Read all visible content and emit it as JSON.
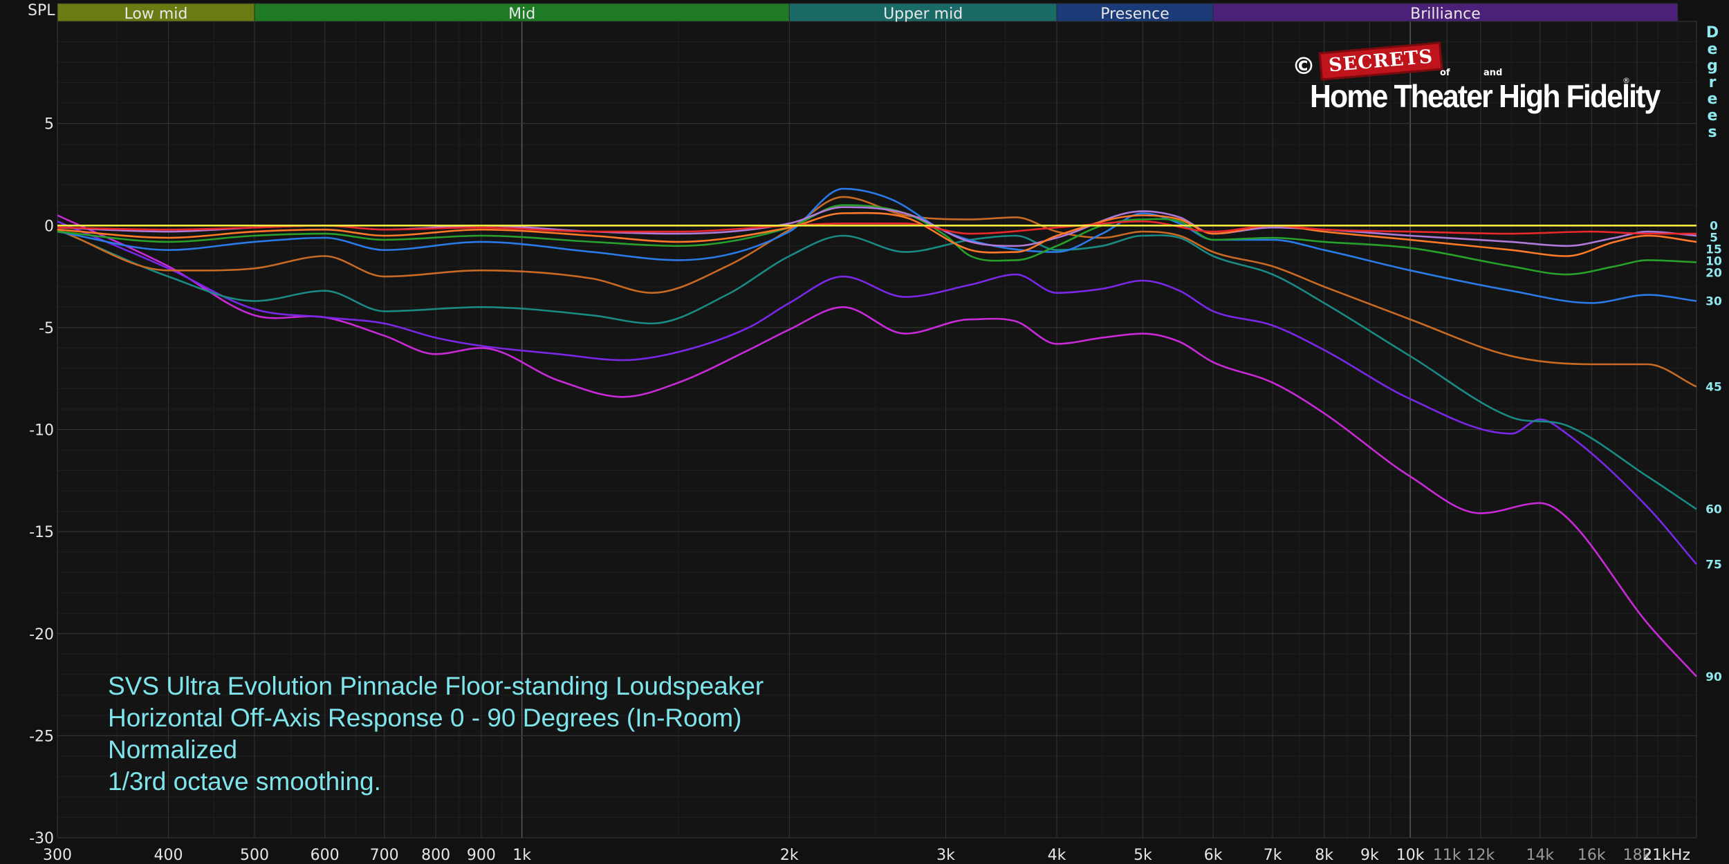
{
  "chart_data": {
    "type": "line",
    "ylabel": "SPL",
    "xunit_label": "21kHz",
    "secondary_axis_title": "Degrees",
    "ylim": [
      -30,
      10
    ],
    "xlim": [
      300,
      21000
    ],
    "x_scale": "log",
    "grid": true,
    "y_ticks": [
      5,
      0,
      -5,
      -10,
      -15,
      -20,
      -25,
      -30
    ],
    "x_ticks": [
      {
        "value": 300,
        "label": "300"
      },
      {
        "value": 400,
        "label": "400"
      },
      {
        "value": 500,
        "label": "500"
      },
      {
        "value": 600,
        "label": "600"
      },
      {
        "value": 700,
        "label": "700"
      },
      {
        "value": 800,
        "label": "800"
      },
      {
        "value": 900,
        "label": "900"
      },
      {
        "value": 1000,
        "label": "1k"
      },
      {
        "value": 2000,
        "label": "2k"
      },
      {
        "value": 3000,
        "label": "3k"
      },
      {
        "value": 4000,
        "label": "4k"
      },
      {
        "value": 5000,
        "label": "5k"
      },
      {
        "value": 6000,
        "label": "6k"
      },
      {
        "value": 7000,
        "label": "7k"
      },
      {
        "value": 8000,
        "label": "8k"
      },
      {
        "value": 9000,
        "label": "9k"
      },
      {
        "value": 10000,
        "label": "10k"
      },
      {
        "value": 11000,
        "label": "11k",
        "dim": true
      },
      {
        "value": 12000,
        "label": "12k",
        "dim": true
      },
      {
        "value": 14000,
        "label": "14k",
        "dim": true
      },
      {
        "value": 16000,
        "label": "16k",
        "dim": true
      },
      {
        "value": 18000,
        "label": "18k",
        "dim": true
      }
    ],
    "bands": [
      {
        "label": "Low mid",
        "from": 300,
        "to": 500,
        "color": "#6b7a12"
      },
      {
        "label": "Mid",
        "from": 500,
        "to": 2000,
        "color": "#1e7a24"
      },
      {
        "label": "Upper mid",
        "from": 2000,
        "to": 4000,
        "color": "#1a6b68"
      },
      {
        "label": "Presence",
        "from": 4000,
        "to": 6000,
        "color": "#1a3a78"
      },
      {
        "label": "Brilliance",
        "from": 6000,
        "to": 20000,
        "color": "#4a2078"
      }
    ],
    "series": [
      {
        "name": "0",
        "color": "#f2ea3c",
        "points": [
          [
            300,
            0
          ],
          [
            21000,
            0
          ]
        ]
      },
      {
        "name": "5",
        "color": "#e8282a",
        "points": [
          [
            300,
            -0.1
          ],
          [
            400,
            -0.2
          ],
          [
            500,
            -0.1
          ],
          [
            600,
            0
          ],
          [
            700,
            -0.2
          ],
          [
            900,
            -0.1
          ],
          [
            1200,
            -0.3
          ],
          [
            1500,
            -0.3
          ],
          [
            2000,
            0
          ],
          [
            2300,
            0.1
          ],
          [
            2700,
            0.1
          ],
          [
            3200,
            -0.4
          ],
          [
            4000,
            -0.1
          ],
          [
            5000,
            0.2
          ],
          [
            6000,
            -0.3
          ],
          [
            7000,
            0
          ],
          [
            8000,
            -0.2
          ],
          [
            10000,
            -0.3
          ],
          [
            13000,
            -0.4
          ],
          [
            16000,
            -0.3
          ],
          [
            18500,
            -0.4
          ],
          [
            21000,
            -0.4
          ]
        ]
      },
      {
        "name": "10",
        "color": "#ff7a28",
        "points": [
          [
            300,
            -0.2
          ],
          [
            400,
            -0.6
          ],
          [
            500,
            -0.3
          ],
          [
            600,
            -0.2
          ],
          [
            700,
            -0.5
          ],
          [
            900,
            -0.2
          ],
          [
            1200,
            -0.5
          ],
          [
            1500,
            -0.8
          ],
          [
            2000,
            -0.1
          ],
          [
            2300,
            0.6
          ],
          [
            2700,
            0.4
          ],
          [
            3200,
            -1.2
          ],
          [
            3600,
            -1.3
          ],
          [
            4000,
            -0.5
          ],
          [
            5000,
            0.5
          ],
          [
            5500,
            0.3
          ],
          [
            6000,
            -0.4
          ],
          [
            7000,
            0
          ],
          [
            8000,
            -0.3
          ],
          [
            10000,
            -0.7
          ],
          [
            13000,
            -1.2
          ],
          [
            15000,
            -1.5
          ],
          [
            17000,
            -0.8
          ],
          [
            18500,
            -0.5
          ],
          [
            21000,
            -0.8
          ]
        ]
      },
      {
        "name": "15",
        "color": "#b07ad8",
        "points": [
          [
            300,
            -0.1
          ],
          [
            400,
            -0.3
          ],
          [
            500,
            -0.1
          ],
          [
            600,
            0
          ],
          [
            700,
            -0.2
          ],
          [
            900,
            0
          ],
          [
            1200,
            -0.3
          ],
          [
            1500,
            -0.4
          ],
          [
            2000,
            0.1
          ],
          [
            2300,
            0.9
          ],
          [
            2700,
            0.6
          ],
          [
            3200,
            -0.8
          ],
          [
            3600,
            -1
          ],
          [
            4000,
            -0.6
          ],
          [
            5000,
            0.7
          ],
          [
            5500,
            0.4
          ],
          [
            6000,
            -0.4
          ],
          [
            7000,
            -0.1
          ],
          [
            8000,
            -0.2
          ],
          [
            10000,
            -0.5
          ],
          [
            13000,
            -0.8
          ],
          [
            15000,
            -1
          ],
          [
            17000,
            -0.6
          ],
          [
            18500,
            -0.3
          ],
          [
            21000,
            -0.5
          ]
        ]
      },
      {
        "name": "20",
        "color": "#28a02c",
        "points": [
          [
            300,
            -0.3
          ],
          [
            400,
            -0.8
          ],
          [
            500,
            -0.5
          ],
          [
            600,
            -0.4
          ],
          [
            700,
            -0.7
          ],
          [
            900,
            -0.5
          ],
          [
            1200,
            -0.8
          ],
          [
            1500,
            -1
          ],
          [
            2000,
            -0.1
          ],
          [
            2300,
            1
          ],
          [
            2700,
            0.6
          ],
          [
            3000,
            -0.5
          ],
          [
            3200,
            -1.5
          ],
          [
            3600,
            -1.7
          ],
          [
            4000,
            -1
          ],
          [
            4500,
            0
          ],
          [
            5000,
            0.3
          ],
          [
            5500,
            0.2
          ],
          [
            6000,
            -0.7
          ],
          [
            7000,
            -0.6
          ],
          [
            8000,
            -0.8
          ],
          [
            10000,
            -1.1
          ],
          [
            13000,
            -2
          ],
          [
            15000,
            -2.4
          ],
          [
            17000,
            -2
          ],
          [
            18500,
            -1.7
          ],
          [
            21000,
            -1.8
          ]
        ]
      },
      {
        "name": "30",
        "color": "#2a7ae8",
        "points": [
          [
            300,
            -0.3
          ],
          [
            400,
            -1.2
          ],
          [
            500,
            -0.8
          ],
          [
            600,
            -0.6
          ],
          [
            700,
            -1.2
          ],
          [
            900,
            -0.8
          ],
          [
            1200,
            -1.3
          ],
          [
            1500,
            -1.7
          ],
          [
            2000,
            -0.3
          ],
          [
            2300,
            1.8
          ],
          [
            2600,
            1.3
          ],
          [
            3000,
            -0.3
          ],
          [
            3400,
            -1
          ],
          [
            4000,
            -1.3
          ],
          [
            4500,
            -0.4
          ],
          [
            5000,
            0.6
          ],
          [
            5500,
            0.1
          ],
          [
            6000,
            -0.7
          ],
          [
            7000,
            -0.7
          ],
          [
            8000,
            -1.2
          ],
          [
            10000,
            -2.2
          ],
          [
            13000,
            -3.2
          ],
          [
            16000,
            -3.8
          ],
          [
            18500,
            -3.4
          ],
          [
            21000,
            -3.7
          ]
        ]
      },
      {
        "name": "45",
        "color": "#c86a24",
        "points": [
          [
            300,
            -0.2
          ],
          [
            400,
            -2.2
          ],
          [
            500,
            -2.1
          ],
          [
            600,
            -1.5
          ],
          [
            700,
            -2.5
          ],
          [
            900,
            -2.2
          ],
          [
            1200,
            -2.6
          ],
          [
            1400,
            -3.3
          ],
          [
            1700,
            -2
          ],
          [
            2000,
            -0.2
          ],
          [
            2300,
            1.4
          ],
          [
            2700,
            0.5
          ],
          [
            3200,
            0.3
          ],
          [
            3600,
            0.4
          ],
          [
            4000,
            -0.3
          ],
          [
            4500,
            -0.6
          ],
          [
            5000,
            -0.3
          ],
          [
            5500,
            -0.5
          ],
          [
            6000,
            -1.3
          ],
          [
            7000,
            -2
          ],
          [
            8000,
            -3
          ],
          [
            10000,
            -4.6
          ],
          [
            13000,
            -6.4
          ],
          [
            16000,
            -6.8
          ],
          [
            18500,
            -6.8
          ],
          [
            21000,
            -7.9
          ]
        ]
      },
      {
        "name": "60",
        "color": "#1a8a84",
        "points": [
          [
            300,
            -0.2
          ],
          [
            400,
            -2.5
          ],
          [
            500,
            -3.7
          ],
          [
            600,
            -3.2
          ],
          [
            700,
            -4.2
          ],
          [
            900,
            -4
          ],
          [
            1200,
            -4.4
          ],
          [
            1400,
            -4.8
          ],
          [
            1700,
            -3.4
          ],
          [
            2000,
            -1.5
          ],
          [
            2300,
            -0.5
          ],
          [
            2700,
            -1.3
          ],
          [
            3200,
            -0.7
          ],
          [
            3600,
            -0.5
          ],
          [
            4000,
            -1.2
          ],
          [
            4500,
            -1
          ],
          [
            5000,
            -0.5
          ],
          [
            5500,
            -0.6
          ],
          [
            6000,
            -1.5
          ],
          [
            7000,
            -2.4
          ],
          [
            8000,
            -3.8
          ],
          [
            10000,
            -6.4
          ],
          [
            13000,
            -9.4
          ],
          [
            15000,
            -9.8
          ],
          [
            18500,
            -12.3
          ],
          [
            21000,
            -13.9
          ]
        ]
      },
      {
        "name": "75",
        "color": "#7a28e8",
        "points": [
          [
            300,
            0.2
          ],
          [
            400,
            -2.1
          ],
          [
            500,
            -4.1
          ],
          [
            600,
            -4.5
          ],
          [
            700,
            -4.8
          ],
          [
            800,
            -5.5
          ],
          [
            900,
            -5.9
          ],
          [
            1100,
            -6.3
          ],
          [
            1300,
            -6.6
          ],
          [
            1500,
            -6.2
          ],
          [
            1800,
            -5
          ],
          [
            2000,
            -3.8
          ],
          [
            2300,
            -2.5
          ],
          [
            2700,
            -3.5
          ],
          [
            3200,
            -2.9
          ],
          [
            3600,
            -2.4
          ],
          [
            4000,
            -3.3
          ],
          [
            4500,
            -3.1
          ],
          [
            5000,
            -2.7
          ],
          [
            5500,
            -3.2
          ],
          [
            6000,
            -4.2
          ],
          [
            7000,
            -4.9
          ],
          [
            8000,
            -6.1
          ],
          [
            10000,
            -8.5
          ],
          [
            13000,
            -10.2
          ],
          [
            14000,
            -9.5
          ],
          [
            15000,
            -10.2
          ],
          [
            18500,
            -13.8
          ],
          [
            21000,
            -16.6
          ]
        ]
      },
      {
        "name": "90",
        "color": "#c82ad8",
        "points": [
          [
            300,
            0.5
          ],
          [
            400,
            -2
          ],
          [
            500,
            -4.4
          ],
          [
            600,
            -4.5
          ],
          [
            700,
            -5.4
          ],
          [
            800,
            -6.3
          ],
          [
            900,
            -6
          ],
          [
            1100,
            -7.6
          ],
          [
            1300,
            -8.4
          ],
          [
            1500,
            -7.7
          ],
          [
            1800,
            -6.1
          ],
          [
            2000,
            -5.1
          ],
          [
            2300,
            -4
          ],
          [
            2700,
            -5.3
          ],
          [
            3200,
            -4.6
          ],
          [
            3600,
            -4.7
          ],
          [
            4000,
            -5.8
          ],
          [
            4500,
            -5.5
          ],
          [
            5000,
            -5.3
          ],
          [
            5500,
            -5.7
          ],
          [
            6000,
            -6.7
          ],
          [
            7000,
            -7.7
          ],
          [
            8000,
            -9.2
          ],
          [
            10000,
            -12.3
          ],
          [
            12000,
            -14.1
          ],
          [
            14000,
            -13.6
          ],
          [
            15000,
            -14.3
          ],
          [
            18500,
            -19.5
          ],
          [
            21000,
            -22.1
          ]
        ]
      }
    ],
    "annotation_lines": [
      "SVS Ultra Evolution Pinnacle Floor-standing Loudspeaker",
      "Horizontal Off-Axis Response 0 - 90 Degrees (In-Room)",
      "Normalized",
      "1/3rd octave smoothing."
    ]
  },
  "logo": {
    "copyright": "©",
    "secrets": "SECRETS",
    "of": "of",
    "and": "and",
    "brand": "Home Theater High Fidelity",
    "reg": "®"
  }
}
